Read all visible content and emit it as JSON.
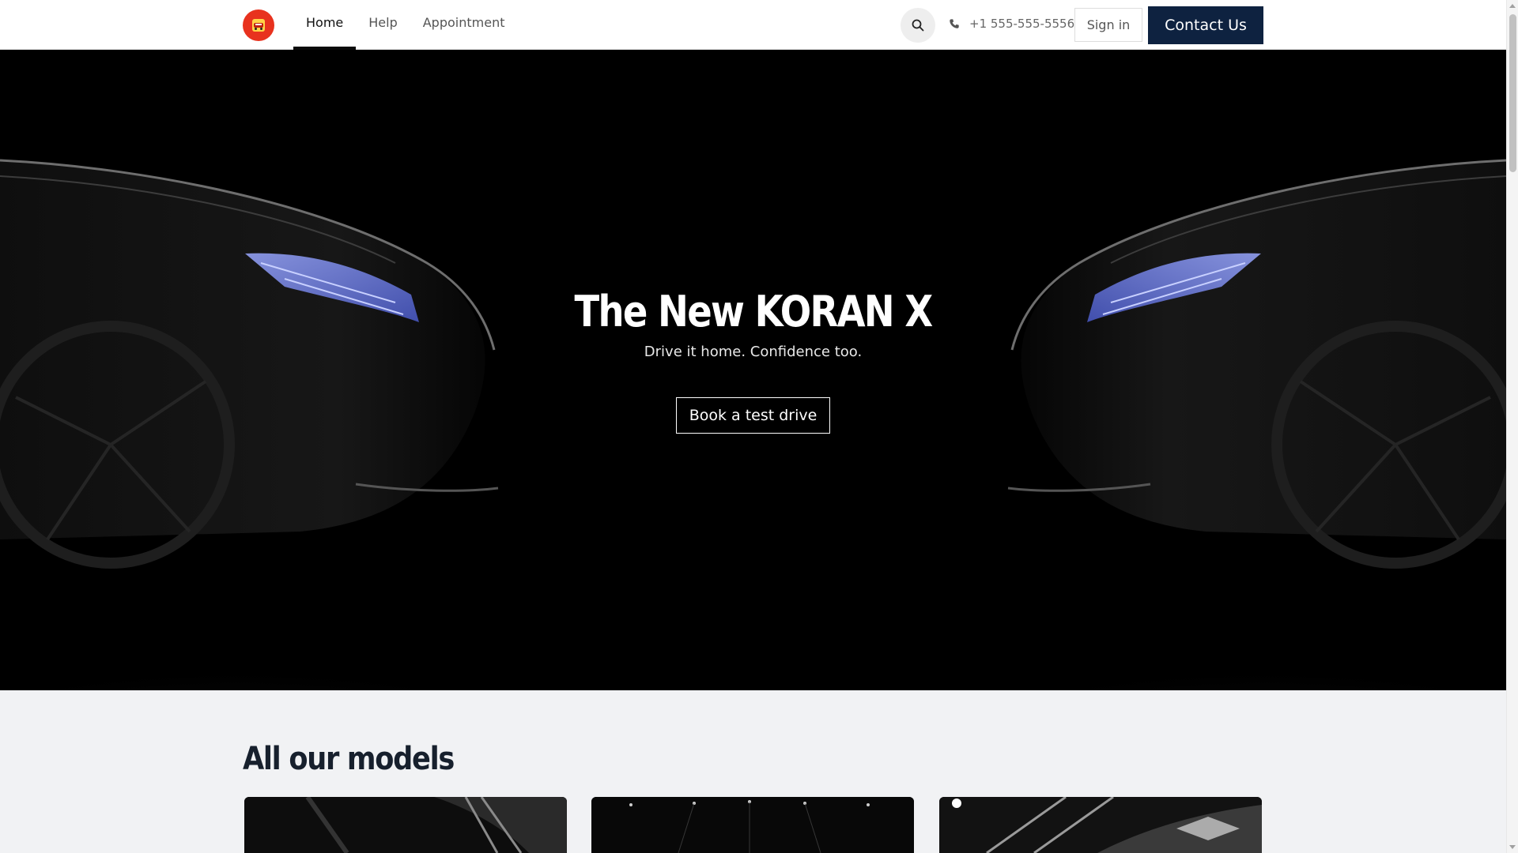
{
  "header": {
    "logo_icon": "car-icon",
    "nav": [
      {
        "label": "Home",
        "active": true
      },
      {
        "label": "Help",
        "active": false
      },
      {
        "label": "Appointment",
        "active": false
      }
    ],
    "search_icon": "search-icon",
    "phone": "+1 555-555-5556",
    "signin_label": "Sign in",
    "contact_label": "Contact Us"
  },
  "hero": {
    "title": "The New KORAN X",
    "subtitle": "Drive it home. Confidence too.",
    "cta_label": "Book a test drive"
  },
  "models": {
    "title": "All our models",
    "cards": [
      {
        "image": "wheel-closeup"
      },
      {
        "image": "showroom-lights"
      },
      {
        "image": "car-body-reflection"
      }
    ]
  },
  "colors": {
    "logo": "#e8321e",
    "contact_button": "#0e2240",
    "hero_background": "#000000",
    "section_background": "#f1f2f4",
    "section_title": "#17202d"
  }
}
